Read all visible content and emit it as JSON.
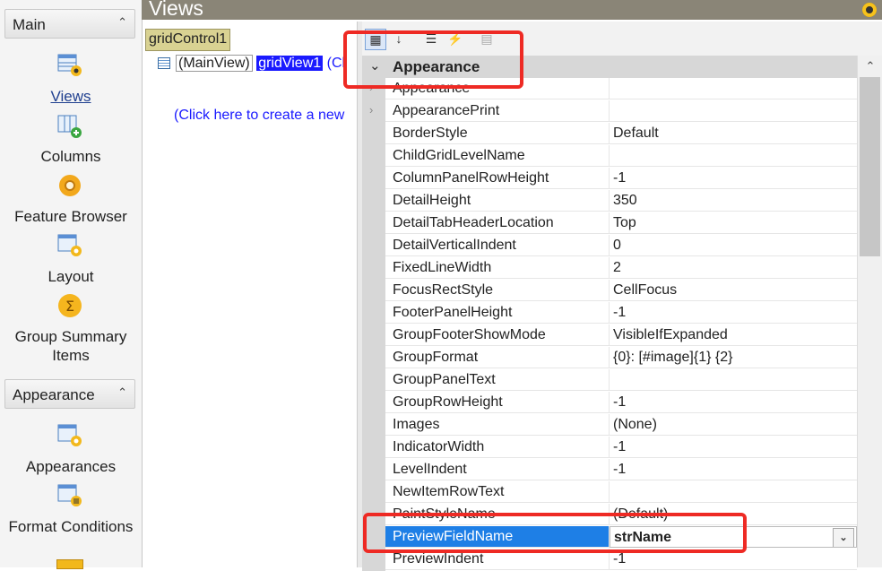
{
  "window": {
    "title": "Views"
  },
  "sidebar": {
    "groups": [
      {
        "label": "Main",
        "items": [
          {
            "label": "Views",
            "icon": "views-icon",
            "selected": true
          },
          {
            "label": "Columns",
            "icon": "columns-icon"
          },
          {
            "label": "Feature Browser",
            "icon": "gear-icon"
          },
          {
            "label": "Layout",
            "icon": "layout-icon"
          },
          {
            "label": "Group Summary Items",
            "icon": "sigma-icon"
          }
        ]
      },
      {
        "label": "Appearance",
        "items": [
          {
            "label": "Appearances",
            "icon": "appearances-icon"
          },
          {
            "label": "Format Conditions",
            "icon": "format-conditions-icon"
          }
        ]
      }
    ]
  },
  "tree": {
    "grid_control": "gridControl1",
    "main_view": "(MainView)",
    "view_name": "gridView1",
    "view_link": "(Cl",
    "create_link": "(Click here to create a new"
  },
  "property_grid": {
    "category": "Appearance",
    "rows": [
      {
        "name": "Appearance",
        "value": "",
        "expandable": true
      },
      {
        "name": "AppearancePrint",
        "value": "",
        "expandable": true
      },
      {
        "name": "BorderStyle",
        "value": "Default"
      },
      {
        "name": "ChildGridLevelName",
        "value": ""
      },
      {
        "name": "ColumnPanelRowHeight",
        "value": "-1"
      },
      {
        "name": "DetailHeight",
        "value": "350"
      },
      {
        "name": "DetailTabHeaderLocation",
        "value": "Top"
      },
      {
        "name": "DetailVerticalIndent",
        "value": "0"
      },
      {
        "name": "FixedLineWidth",
        "value": "2"
      },
      {
        "name": "FocusRectStyle",
        "value": "CellFocus"
      },
      {
        "name": "FooterPanelHeight",
        "value": "-1"
      },
      {
        "name": "GroupFooterShowMode",
        "value": "VisibleIfExpanded"
      },
      {
        "name": "GroupFormat",
        "value": "{0}: [#image]{1} {2}"
      },
      {
        "name": "GroupPanelText",
        "value": ""
      },
      {
        "name": "GroupRowHeight",
        "value": "-1"
      },
      {
        "name": "Images",
        "value": "(None)"
      },
      {
        "name": "IndicatorWidth",
        "value": "-1"
      },
      {
        "name": "LevelIndent",
        "value": "-1"
      },
      {
        "name": "NewItemRowText",
        "value": ""
      },
      {
        "name": "PaintStyleName",
        "value": "(Default)"
      },
      {
        "name": "PreviewFieldName",
        "value": "strName",
        "selected": true
      },
      {
        "name": "PreviewIndent",
        "value": "-1"
      }
    ]
  },
  "colors": {
    "selection": "#1e7fe6",
    "highlight": "#ee2a24",
    "category_bg": "#d7d7d7",
    "tree_selection": "#1a1aff"
  }
}
